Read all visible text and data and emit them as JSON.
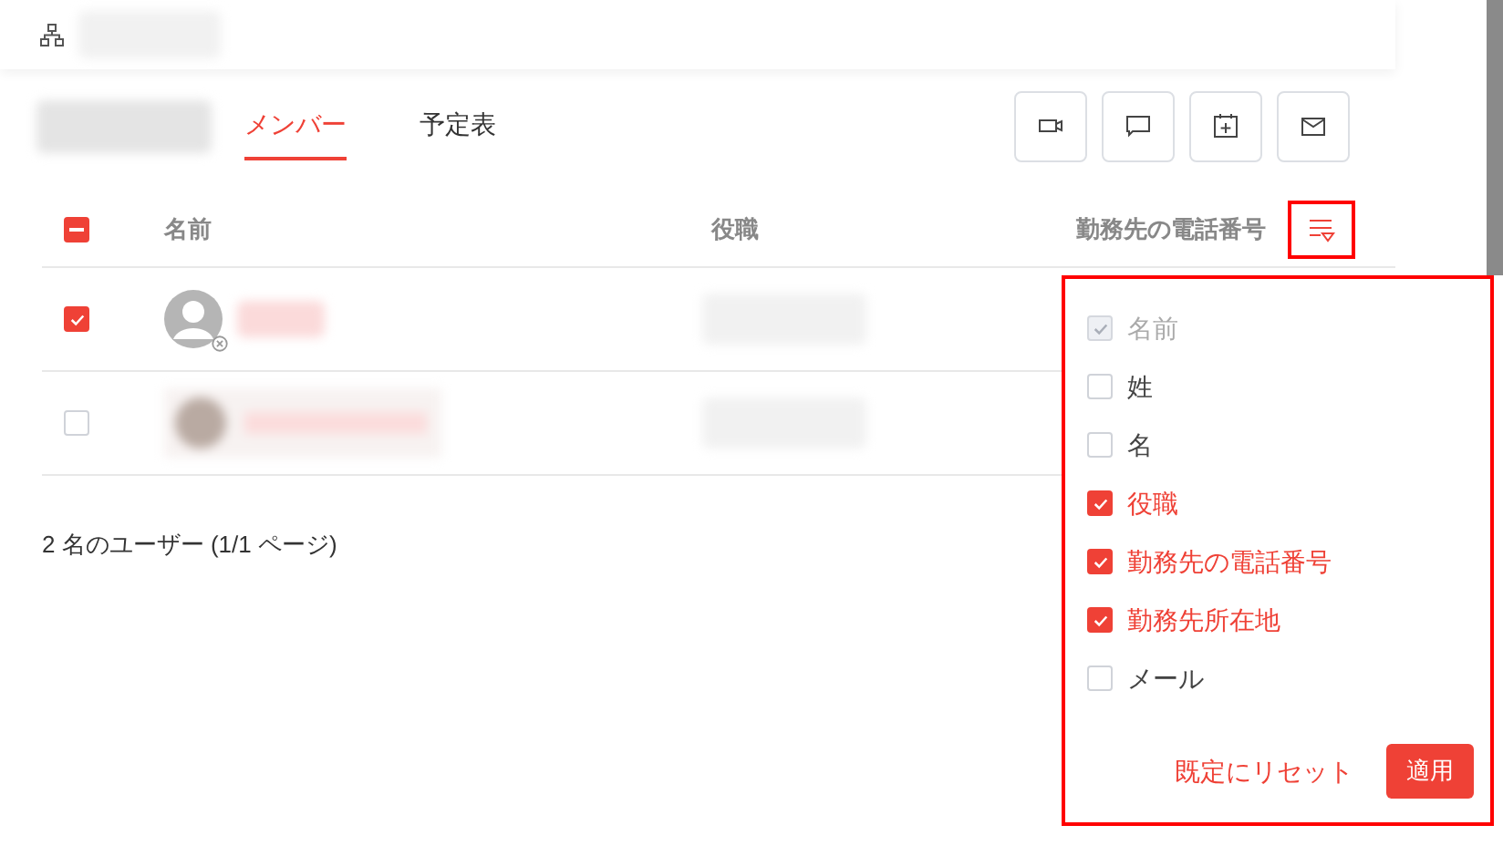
{
  "tabs": [
    {
      "label": "メンバー",
      "selected": true
    },
    {
      "label": "予定表",
      "selected": false
    }
  ],
  "table": {
    "select_all": {
      "checked": true,
      "partial": true
    },
    "columns": [
      "名前",
      "役職",
      "勤務先の電話番号"
    ],
    "rows": [
      {
        "selected": true,
        "kind": "default-avatar"
      },
      {
        "selected": false,
        "kind": "photo"
      }
    ]
  },
  "footer": "2 名のユーザー (1/1 ページ)",
  "column_picker": {
    "items": [
      {
        "label": "名前",
        "checked": true,
        "disabled": true
      },
      {
        "label": "姓",
        "checked": false,
        "disabled": false
      },
      {
        "label": "名",
        "checked": false,
        "disabled": false
      },
      {
        "label": "役職",
        "checked": true,
        "disabled": false
      },
      {
        "label": "勤務先の電話番号",
        "checked": true,
        "disabled": false
      },
      {
        "label": "勤務先所在地",
        "checked": true,
        "disabled": false
      },
      {
        "label": "メール",
        "checked": false,
        "disabled": false
      }
    ],
    "reset": "既定にリセット",
    "apply": "適用"
  }
}
